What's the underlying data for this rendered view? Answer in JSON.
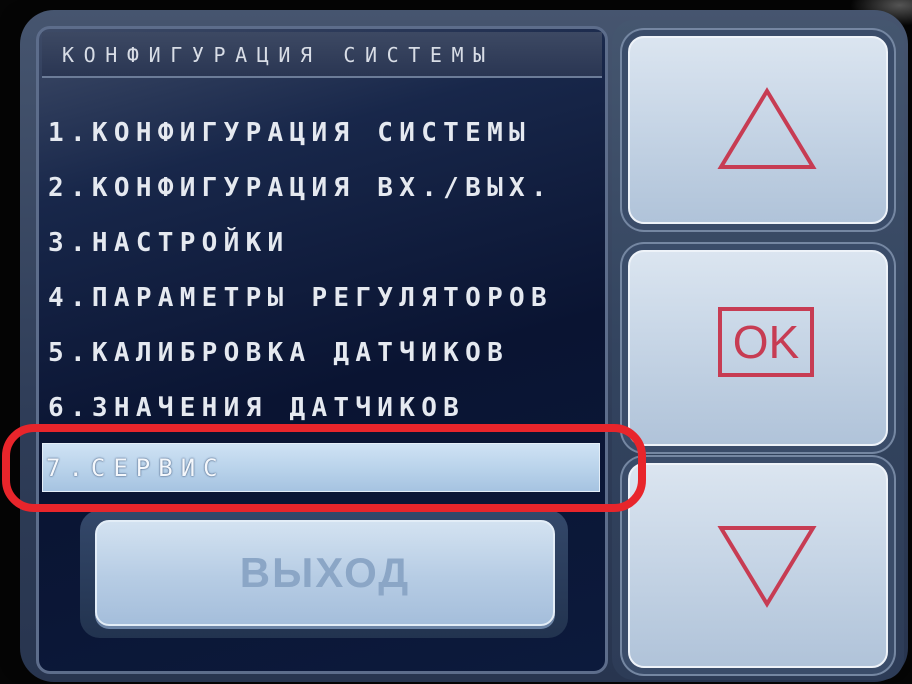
{
  "header": {
    "title": "КОНФИГУРАЦИЯ СИСТЕМЫ"
  },
  "menu": {
    "items": [
      {
        "label": "1.КОНФИГУРАЦИЯ СИСТЕМЫ",
        "selected": false
      },
      {
        "label": "2.КОНФИГУРАЦИЯ ВХ./ВЫХ.",
        "selected": false
      },
      {
        "label": "3.НАСТРОЙКИ",
        "selected": false
      },
      {
        "label": "4.ПАРАМЕТРЫ РЕГУЛЯТОРОВ",
        "selected": false
      },
      {
        "label": "5.КАЛИБРОВКА ДАТЧИКОВ",
        "selected": false
      },
      {
        "label": "6.ЗНАЧЕНИЯ ДАТЧИКОВ",
        "selected": false
      },
      {
        "label": "7.СЕРВИС",
        "selected": true
      }
    ]
  },
  "exit_button": {
    "label": "ВЫХОД"
  },
  "nav": {
    "up_icon": "triangle-up-icon",
    "ok_label": "OK",
    "down_icon": "triangle-down-icon"
  },
  "colors": {
    "annotation": "#e8252b",
    "selection": "#b8d2ea",
    "icon": "#c73c53",
    "panel": "#0b1532"
  }
}
